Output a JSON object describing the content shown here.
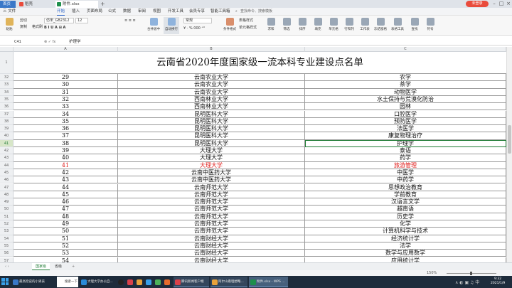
{
  "titlebar": {
    "tabs": [
      {
        "label": "首页"
      },
      {
        "label": "稻壳"
      },
      {
        "label": "附件.xlsx"
      }
    ],
    "login_label": "未登录"
  },
  "menubar": {
    "items": [
      "三 文件",
      "开始",
      "插入",
      "页面布局",
      "公式",
      "数据",
      "审阅",
      "视图",
      "开发工具",
      "会员专享",
      "智能工具箱"
    ],
    "active_index": 1,
    "search_placeholder": "查找命令、搜索模板"
  },
  "ribbon": {
    "paste": "粘贴",
    "cut": "剪切",
    "copy": "复制",
    "format_painter": "格式刷",
    "font_name": "仿宋_GB2312",
    "font_size": "12",
    "wrap": "换行",
    "merge": "合并居中",
    "auto_wrap": "自动换行",
    "format": "常规",
    "cond_format": "条件格式",
    "table_style": "表格样式",
    "cell_style": "单元格样式",
    "sum": "求和",
    "filter": "筛选",
    "sort": "排序",
    "fill": "填充",
    "cell": "单元格",
    "row_col": "行和列",
    "worksheet": "工作表",
    "freeze": "冻结窗格",
    "table_tools": "表格工具",
    "find": "查找",
    "symbol": "符号"
  },
  "formula": {
    "cell_ref": "C41",
    "fx": "fx",
    "value": "护理学"
  },
  "columns": [
    "A",
    "B",
    "C"
  ],
  "sheet": {
    "title_row_num": "1",
    "title": "云南省2020年度国家级一流本科专业建设点名单",
    "rows": [
      {
        "rn": "32",
        "a": "29",
        "b": "云南农业大学",
        "c": "农学"
      },
      {
        "rn": "33",
        "a": "30",
        "b": "云南农业大学",
        "c": "茶学"
      },
      {
        "rn": "34",
        "a": "31",
        "b": "云南农业大学",
        "c": "动物医学"
      },
      {
        "rn": "35",
        "a": "32",
        "b": "西南林业大学",
        "c": "水土保持与荒漠化防治"
      },
      {
        "rn": "36",
        "a": "33",
        "b": "西南林业大学",
        "c": "园林"
      },
      {
        "rn": "37",
        "a": "34",
        "b": "昆明医科大学",
        "c": "口腔医学"
      },
      {
        "rn": "38",
        "a": "35",
        "b": "昆明医科大学",
        "c": "预防医学"
      },
      {
        "rn": "39",
        "a": "36",
        "b": "昆明医科大学",
        "c": "法医学"
      },
      {
        "rn": "40",
        "a": "37",
        "b": "昆明医科大学",
        "c": "康复物理治疗"
      },
      {
        "rn": "41",
        "a": "38",
        "b": "昆明医科大学",
        "c": "护理学",
        "selected": true
      },
      {
        "rn": "42",
        "a": "39",
        "b": "大理大学",
        "c": "泰语"
      },
      {
        "rn": "43",
        "a": "40",
        "b": "大理大学",
        "c": "药学"
      },
      {
        "rn": "44",
        "a": "41",
        "b": "大理大学",
        "c": "旅游管理",
        "red": true
      },
      {
        "rn": "45",
        "a": "42",
        "b": "云南中医药大学",
        "c": "中医学"
      },
      {
        "rn": "46",
        "a": "43",
        "b": "云南中医药大学",
        "c": "中药学"
      },
      {
        "rn": "47",
        "a": "44",
        "b": "云南师范大学",
        "c": "思想政治教育"
      },
      {
        "rn": "48",
        "a": "45",
        "b": "云南师范大学",
        "c": "学前教育"
      },
      {
        "rn": "49",
        "a": "46",
        "b": "云南师范大学",
        "c": "汉语言文学"
      },
      {
        "rn": "50",
        "a": "47",
        "b": "云南师范大学",
        "c": "越南语"
      },
      {
        "rn": "51",
        "a": "48",
        "b": "云南师范大学",
        "c": "历史学"
      },
      {
        "rn": "52",
        "a": "49",
        "b": "云南师范大学",
        "c": "化学"
      },
      {
        "rn": "53",
        "a": "50",
        "b": "云南师范大学",
        "c": "计算机科学与技术"
      },
      {
        "rn": "54",
        "a": "51",
        "b": "云南财经大学",
        "c": "经济统计学"
      },
      {
        "rn": "55",
        "a": "52",
        "b": "云南财经大学",
        "c": "法学"
      },
      {
        "rn": "56",
        "a": "53",
        "b": "云南财经大学",
        "c": "数学与应用数学"
      },
      {
        "rn": "57",
        "a": "54",
        "b": "云南财经大学",
        "c": "应用统计学"
      }
    ]
  },
  "sheet_tabs": [
    "国家级",
    "省级"
  ],
  "statusbar": {
    "zoom": "150%"
  },
  "taskbar": {
    "items": [
      "最高检说的小男孩",
      "搜索一下",
      "大理大学办公自...",
      "",
      "",
      "",
      "",
      "",
      "",
      "腾讯新闻客户端",
      "阿尔山看理想略...",
      "附件.xlsx - WPS ..."
    ],
    "clock_time": "9:32",
    "clock_date": "2021/1/9"
  },
  "colors": {
    "accent": "#1e7b34",
    "red_text": "#e0201e",
    "wps_blue": "#2b63c6"
  }
}
